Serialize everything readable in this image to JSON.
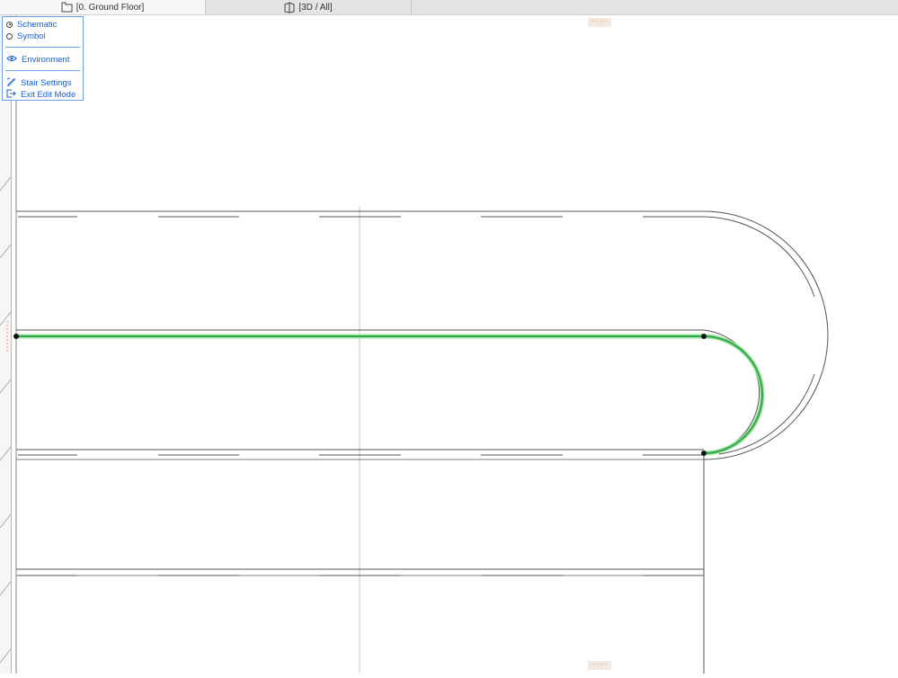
{
  "tabs": [
    {
      "label": "[0. Ground Floor]",
      "icon": "floor-plan-icon",
      "active": true
    },
    {
      "label": "[3D / All]",
      "icon": "3d-view-icon",
      "active": false
    }
  ],
  "edit_menu": {
    "view_options": [
      {
        "label": "Schematic",
        "selected": true
      },
      {
        "label": "Symbol",
        "selected": false
      }
    ],
    "environment": {
      "label": "Environment",
      "icon": "eye-icon"
    },
    "actions": [
      {
        "label": "Stair Settings",
        "icon": "stair-settings-icon"
      },
      {
        "label": "Exit Edit Mode",
        "icon": "exit-icon"
      }
    ]
  },
  "markers": {
    "top": "----",
    "bottom": "----"
  },
  "colors": {
    "accent_menu": "#1a5fd1",
    "walking_line": "#3cb34a",
    "walking_line_glow": "#8fdc8f",
    "outline": "#555555"
  }
}
